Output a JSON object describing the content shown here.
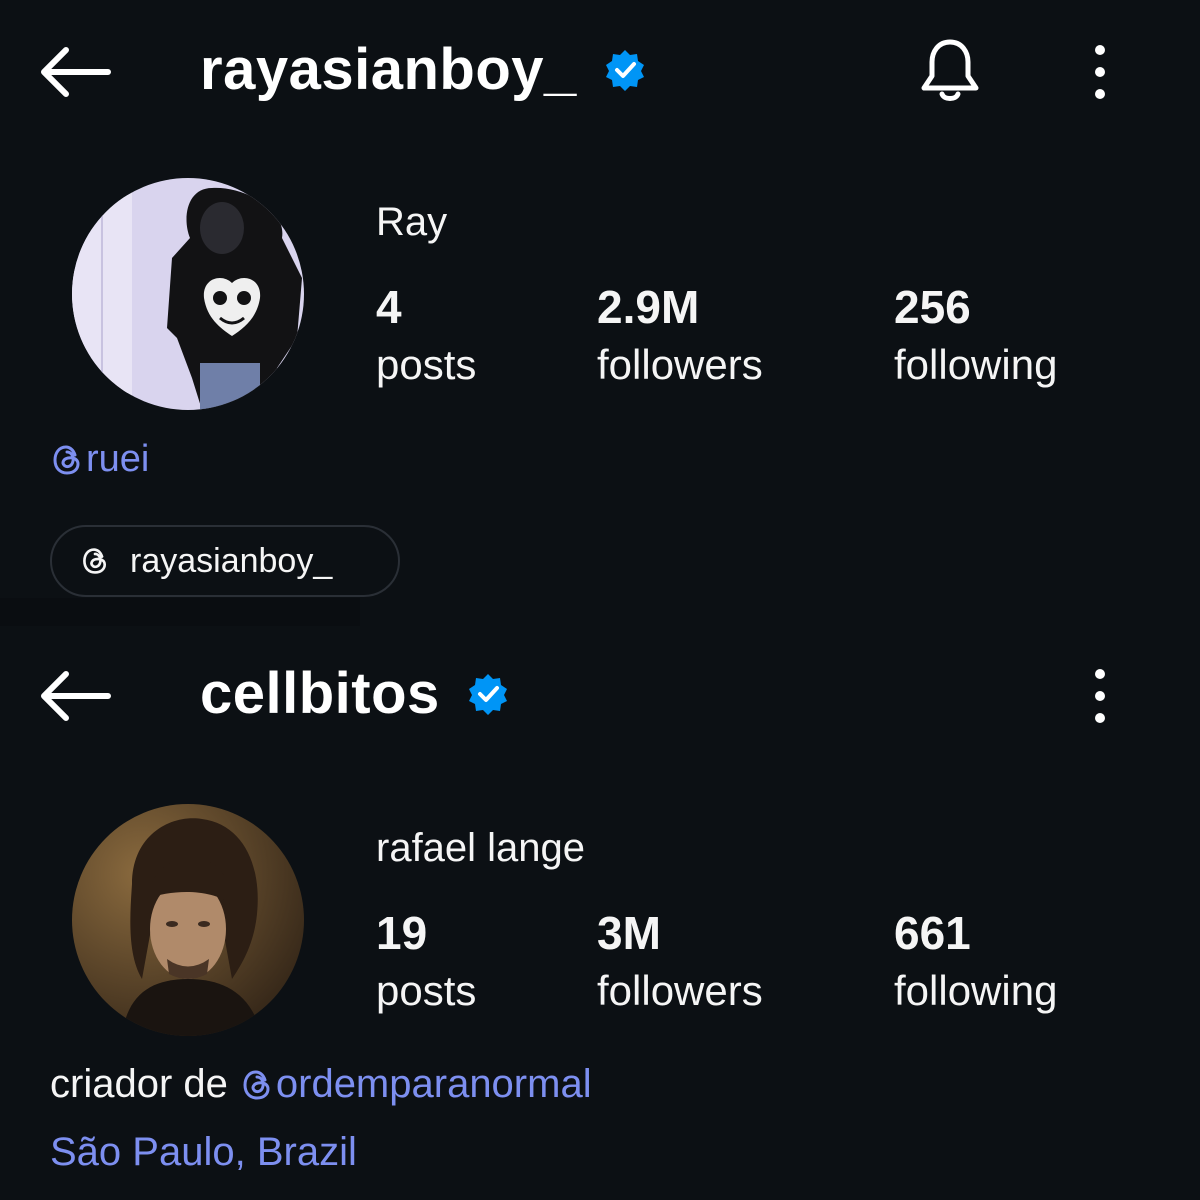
{
  "colors": {
    "background": "#0c1014",
    "verified_blue": "#0095f6",
    "link": "#7d8ff0",
    "text": "#f5f5f5"
  },
  "profiles": [
    {
      "username": "rayasianboy_",
      "verified": true,
      "display_name": "Ray",
      "stats": {
        "posts": {
          "value": "4",
          "label": "posts"
        },
        "followers": {
          "value": "2.9M",
          "label": "followers"
        },
        "following": {
          "value": "256",
          "label": "following"
        }
      },
      "threads_handle": "ruei",
      "threads_badge": "rayasianboy_",
      "icons": [
        "back-arrow-icon",
        "verified-badge-icon",
        "bell-icon",
        "more-vertical-icon",
        "threads-icon"
      ]
    },
    {
      "username": "cellbitos",
      "verified": true,
      "display_name": "rafael lange",
      "stats": {
        "posts": {
          "value": "19",
          "label": "posts"
        },
        "followers": {
          "value": "3M",
          "label": "followers"
        },
        "following": {
          "value": "661",
          "label": "following"
        }
      },
      "bio_prefix": "criador de",
      "bio_mention": "ordemparanormal",
      "location": "São Paulo, Brazil",
      "icons": [
        "back-arrow-icon",
        "verified-badge-icon",
        "more-vertical-icon",
        "threads-icon"
      ]
    }
  ]
}
